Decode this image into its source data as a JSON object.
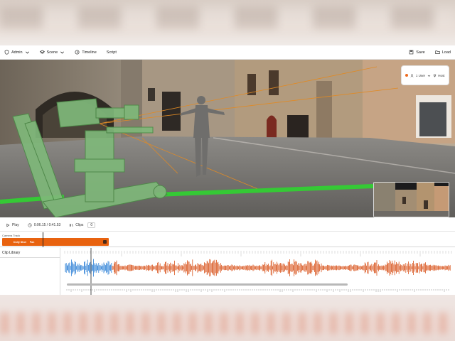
{
  "toolbar": {
    "admin": "Admin",
    "scene": "Scene",
    "timeline": "Timeline",
    "script": "Script",
    "save": "Save",
    "load": "Load"
  },
  "viewport": {
    "users_label": "1 User",
    "host_label": "Host"
  },
  "transport": {
    "play": "Play",
    "time": "0:06.15 / 0:41.53",
    "clips_label": "Clips",
    "clips_count": "0"
  },
  "camera_track": {
    "label": "Camera Track",
    "clip_name": "Dolly Shot",
    "clip_tag": "Pan"
  },
  "library": {
    "title": "Clip Library"
  },
  "colors": {
    "accent": "#e8620f",
    "selected_wave": "#2a7fd6",
    "wave": "#d9541c",
    "guide_green": "#35c935"
  }
}
